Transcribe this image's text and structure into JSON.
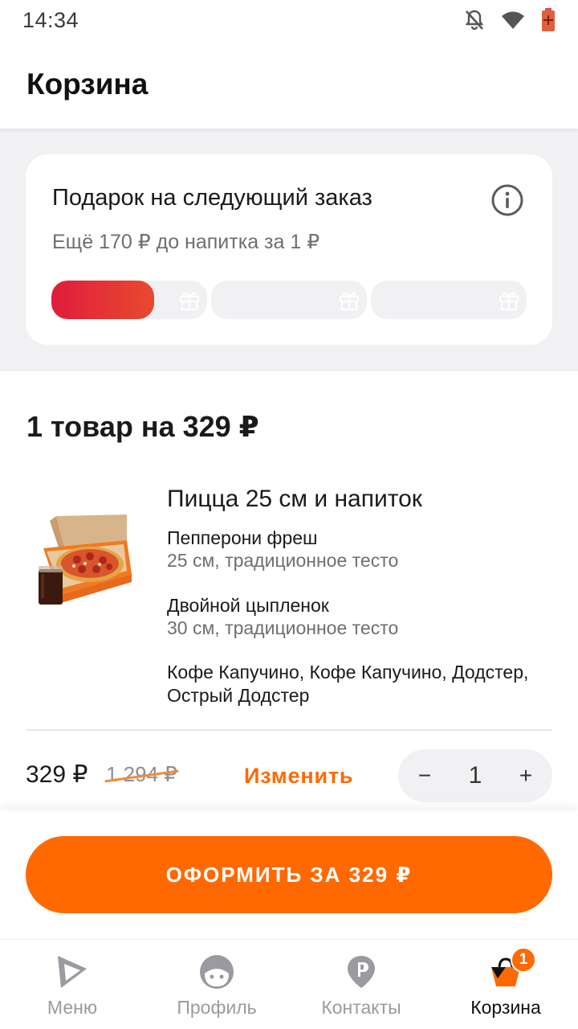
{
  "status_bar": {
    "time": "14:34",
    "icons": [
      "bell-off-icon",
      "wifi-icon",
      "battery-icon"
    ]
  },
  "header": {
    "title": "Корзина"
  },
  "gift": {
    "title": "Подарок на следующий заказ",
    "subtitle": "Ещё 170 ₽ до напитка за 1 ₽",
    "progress": [
      0.66,
      0,
      0
    ],
    "accent_start": "#e01c3c",
    "accent_end": "#e84a2f"
  },
  "cart": {
    "summary": "1 товар на 329 ₽",
    "item": {
      "title": "Пицца 25 см и напиток",
      "lines": [
        {
          "name": "Пепперони фреш",
          "desc": "25 см, традиционное тесто"
        },
        {
          "name": "Двойной цыпленок",
          "desc": "30 см, традиционное тесто"
        }
      ],
      "extras": "Кофе Капучино, Кофе Капучино, Додстер, Острый Додстер",
      "price": "329 ₽",
      "old_price": "1 294 ₽",
      "edit_label": "Изменить",
      "quantity": "1",
      "minus": "−",
      "plus": "+"
    }
  },
  "checkout": {
    "label": "ОФОРМИТЬ ЗА 329 ₽",
    "color": "#ff6900"
  },
  "nav": {
    "items": [
      {
        "label": "Меню",
        "icon": "pizza-slice-icon"
      },
      {
        "label": "Профиль",
        "icon": "face-icon"
      },
      {
        "label": "Контакты",
        "icon": "location-pin-icon"
      },
      {
        "label": "Корзина",
        "icon": "basket-icon",
        "active": true
      }
    ],
    "cart_badge": "1"
  }
}
